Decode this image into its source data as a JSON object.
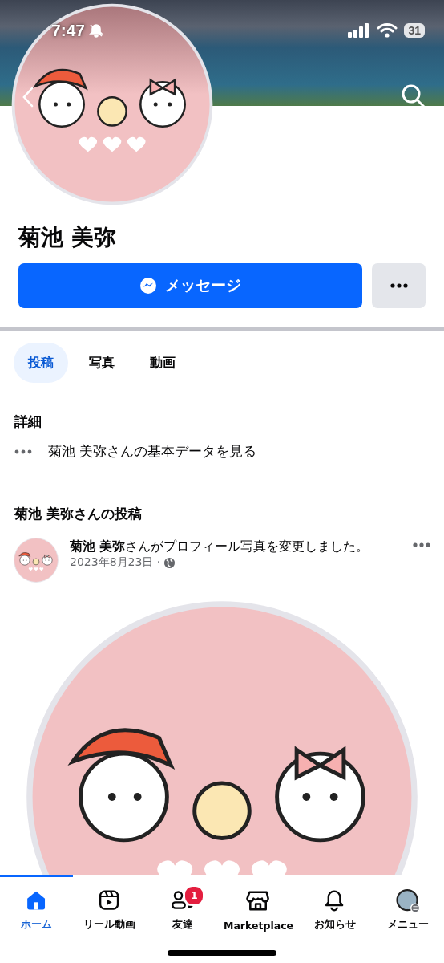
{
  "status_bar": {
    "time": "7:47",
    "battery": "31"
  },
  "profile": {
    "name": "菊池 美弥",
    "message_button": "メッセージ"
  },
  "tabs": [
    {
      "label": "投稿",
      "selected": true
    },
    {
      "label": "写真",
      "selected": false
    },
    {
      "label": "動画",
      "selected": false
    }
  ],
  "details": {
    "heading": "詳細",
    "items": [
      {
        "text": "菊池 美弥さんの基本データを見る"
      }
    ]
  },
  "posts": {
    "heading": "菊池 美弥さんの投稿",
    "items": [
      {
        "text": "**菊池 美弥**さんがプロフィール写真を変更しました。",
        "date": "2023年8月23日 ·"
      }
    ]
  },
  "nav": [
    {
      "kind": "home",
      "label": "ホーム",
      "selected": true
    },
    {
      "kind": "reels",
      "label": "リール動画",
      "selected": false
    },
    {
      "kind": "friends",
      "label": "友達",
      "selected": false,
      "badge": "1"
    },
    {
      "kind": "marketplace",
      "label": "Marketplace",
      "selected": false
    },
    {
      "kind": "bell",
      "label": "お知らせ",
      "selected": false
    },
    {
      "kind": "menu",
      "label": "メニュー",
      "selected": false
    }
  ]
}
